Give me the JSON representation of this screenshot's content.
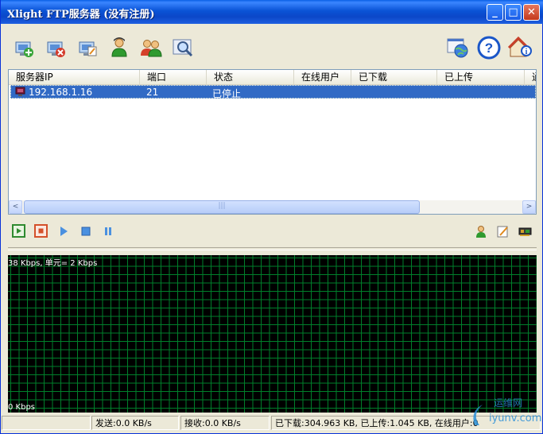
{
  "window": {
    "title": "Xlight FTP服务器 (没有注册)",
    "min_label": "_",
    "max_label": "□",
    "close_label": "✕"
  },
  "toolbar": {
    "left_icons": [
      "add-server-icon",
      "delete-server-icon",
      "edit-server-icon",
      "user-icon",
      "users-icon",
      "search-icon"
    ],
    "right_icons": [
      "globe-window-icon",
      "help-icon",
      "info-home-icon"
    ]
  },
  "server_list": {
    "columns": [
      "服务器IP",
      "端口",
      "状态",
      "在线用户",
      "已下载",
      "已上传",
      "通"
    ],
    "rows": [
      {
        "ip": "192.168.1.16",
        "port": "21",
        "status": "已停止"
      }
    ],
    "scroll_grip": "|||",
    "scroll_left": "<",
    "scroll_right": ">"
  },
  "controls": {
    "left_icons": [
      "start-server-icon",
      "stop-server-icon",
      "play-icon",
      "stop-icon",
      "pause-icon"
    ],
    "right_icons": [
      "online-user-icon",
      "edit-log-icon",
      "network-card-icon"
    ]
  },
  "graph": {
    "top_label": "38 Kbps, 单元= 2 Kbps",
    "bottom_label": "0 Kbps",
    "line_color": "#00802b"
  },
  "statusbar": {
    "send": "发送:0.0 KB/s",
    "receive": "接收:0.0 KB/s",
    "totals": "已下载:304.963 KB, 已上传:1.045 KB, 在线用户:0"
  },
  "watermark": {
    "text_cn": "运维网",
    "text_en": "iyunv.com"
  }
}
